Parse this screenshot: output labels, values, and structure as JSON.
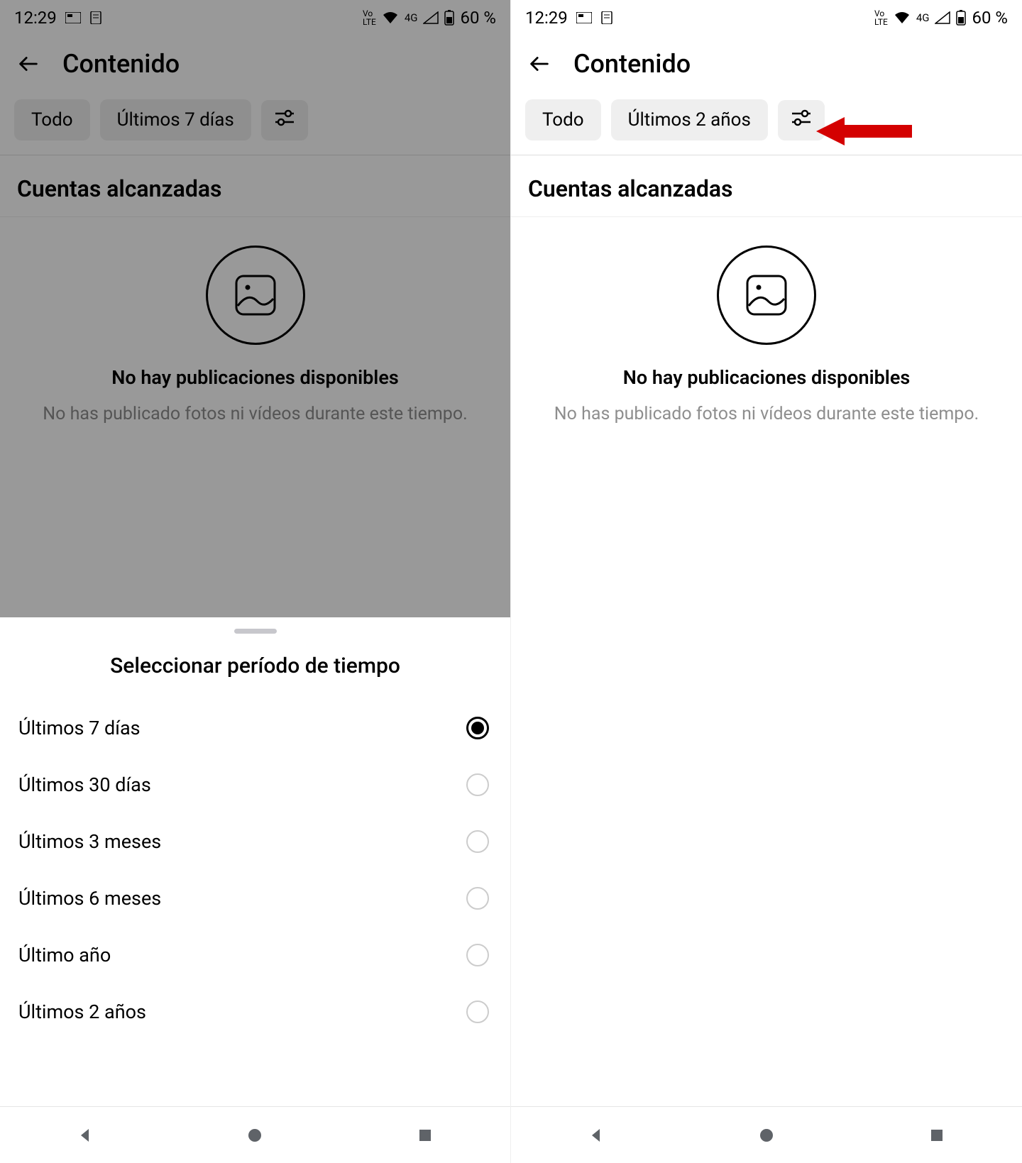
{
  "status": {
    "time": "12:29",
    "battery": "60 %",
    "network_label": "4G",
    "vo_label": "Vo LTE",
    "battery_icon": "battery-icon",
    "wifi_icon": "wifi-icon",
    "signal_icon": "signal-icon"
  },
  "header": {
    "title": "Contenido"
  },
  "left": {
    "chips": {
      "all": "Todo",
      "range": "Últimos 7 días"
    }
  },
  "right": {
    "chips": {
      "all": "Todo",
      "range": "Últimos 2 años"
    }
  },
  "section": {
    "title": "Cuentas alcanzadas"
  },
  "empty": {
    "title": "No hay publicaciones disponibles",
    "sub": "No has publicado fotos ni vídeos durante este tiempo."
  },
  "sheet": {
    "title": "Seleccionar período de tiempo",
    "options": [
      {
        "label": "Últimos 7 días",
        "selected": true
      },
      {
        "label": "Últimos 30 días",
        "selected": false
      },
      {
        "label": "Últimos 3 meses",
        "selected": false
      },
      {
        "label": "Últimos 6 meses",
        "selected": false
      },
      {
        "label": "Último año",
        "selected": false
      },
      {
        "label": "Últimos 2 años",
        "selected": false
      }
    ]
  }
}
